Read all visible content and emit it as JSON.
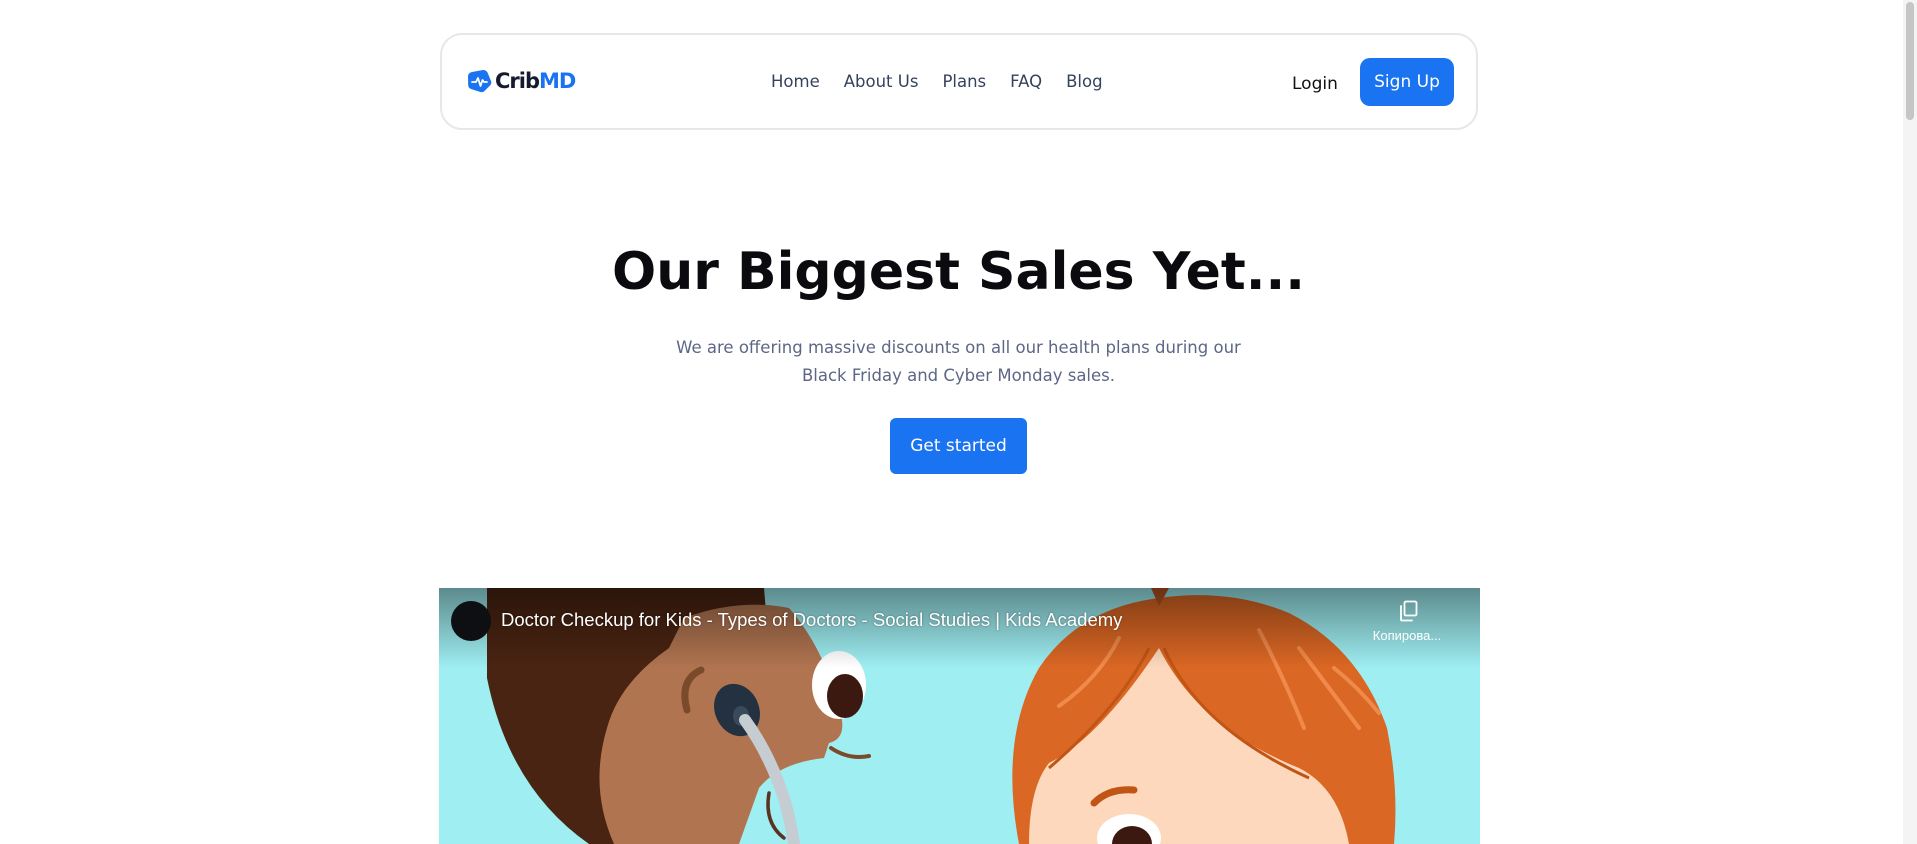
{
  "brand": {
    "name_part1": "Crib",
    "name_part2": "MD",
    "accent": "#1a73f0",
    "dark": "#151b2e"
  },
  "nav": {
    "links": [
      {
        "label": "Home"
      },
      {
        "label": "About Us"
      },
      {
        "label": "Plans"
      },
      {
        "label": "FAQ"
      },
      {
        "label": "Blog"
      }
    ],
    "login_label": "Login",
    "signup_label": "Sign Up"
  },
  "hero": {
    "title": "Our Biggest Sales Yet...",
    "subtitle": "We are offering massive discounts on all our health plans during our Black Friday and Cyber Monday sales.",
    "cta_label": "Get started"
  },
  "video": {
    "title": "Doctor Checkup for Kids - Types of Doctors - Social Studies | Kids Academy",
    "copy_label": "Копирова...",
    "copy_icon": "copy-icon",
    "background": "#9eeef2"
  }
}
